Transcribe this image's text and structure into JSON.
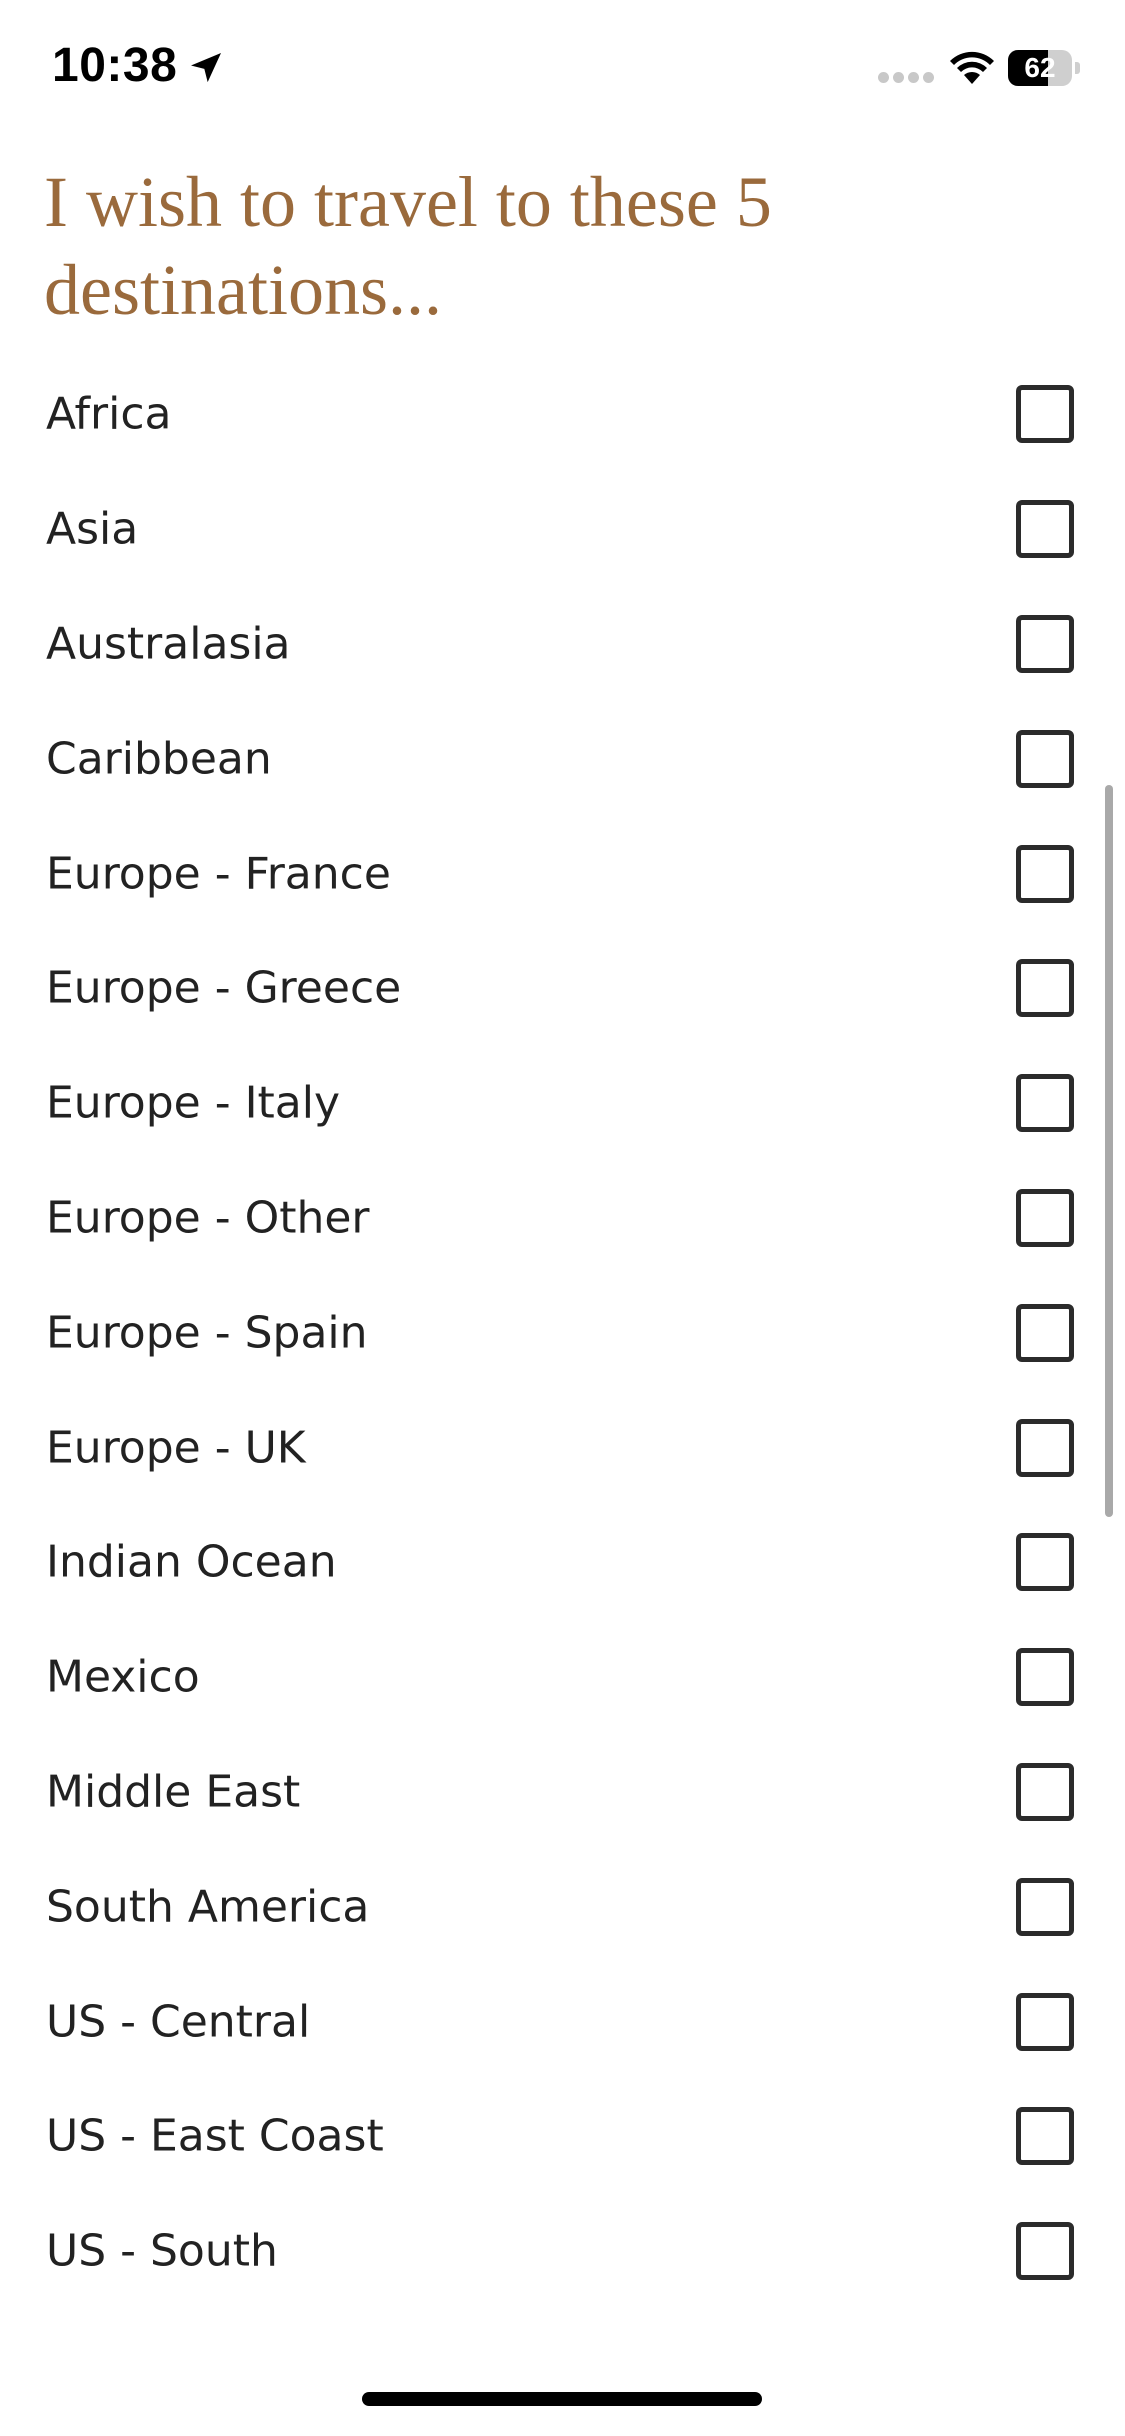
{
  "status_bar": {
    "time": "10:38",
    "battery_level": "62",
    "battery_fraction": 0.62,
    "icons": [
      "location-arrow-icon",
      "cellular-signal-icon",
      "wifi-icon",
      "battery-icon"
    ]
  },
  "page": {
    "title": "I wish to travel to these 5 destinations..."
  },
  "destinations": [
    {
      "label": "Africa",
      "checked": false
    },
    {
      "label": "Asia",
      "checked": false
    },
    {
      "label": "Australasia",
      "checked": false
    },
    {
      "label": "Caribbean",
      "checked": false
    },
    {
      "label": "Europe - France",
      "checked": false
    },
    {
      "label": "Europe - Greece",
      "checked": false
    },
    {
      "label": "Europe - Italy",
      "checked": false
    },
    {
      "label": "Europe - Other",
      "checked": false
    },
    {
      "label": "Europe - Spain",
      "checked": false
    },
    {
      "label": "Europe - UK",
      "checked": false
    },
    {
      "label": "Indian Ocean",
      "checked": false
    },
    {
      "label": "Mexico",
      "checked": false
    },
    {
      "label": "Middle East",
      "checked": false
    },
    {
      "label": "South America",
      "checked": false
    },
    {
      "label": "US - Central",
      "checked": false
    },
    {
      "label": "US - East Coast",
      "checked": false
    },
    {
      "label": "US - South",
      "checked": false
    }
  ],
  "colors": {
    "title": "#9a6a3c",
    "text": "#222222",
    "checkbox_border": "#2b2b2b",
    "scroll_indicator": "#a9a9a9"
  }
}
